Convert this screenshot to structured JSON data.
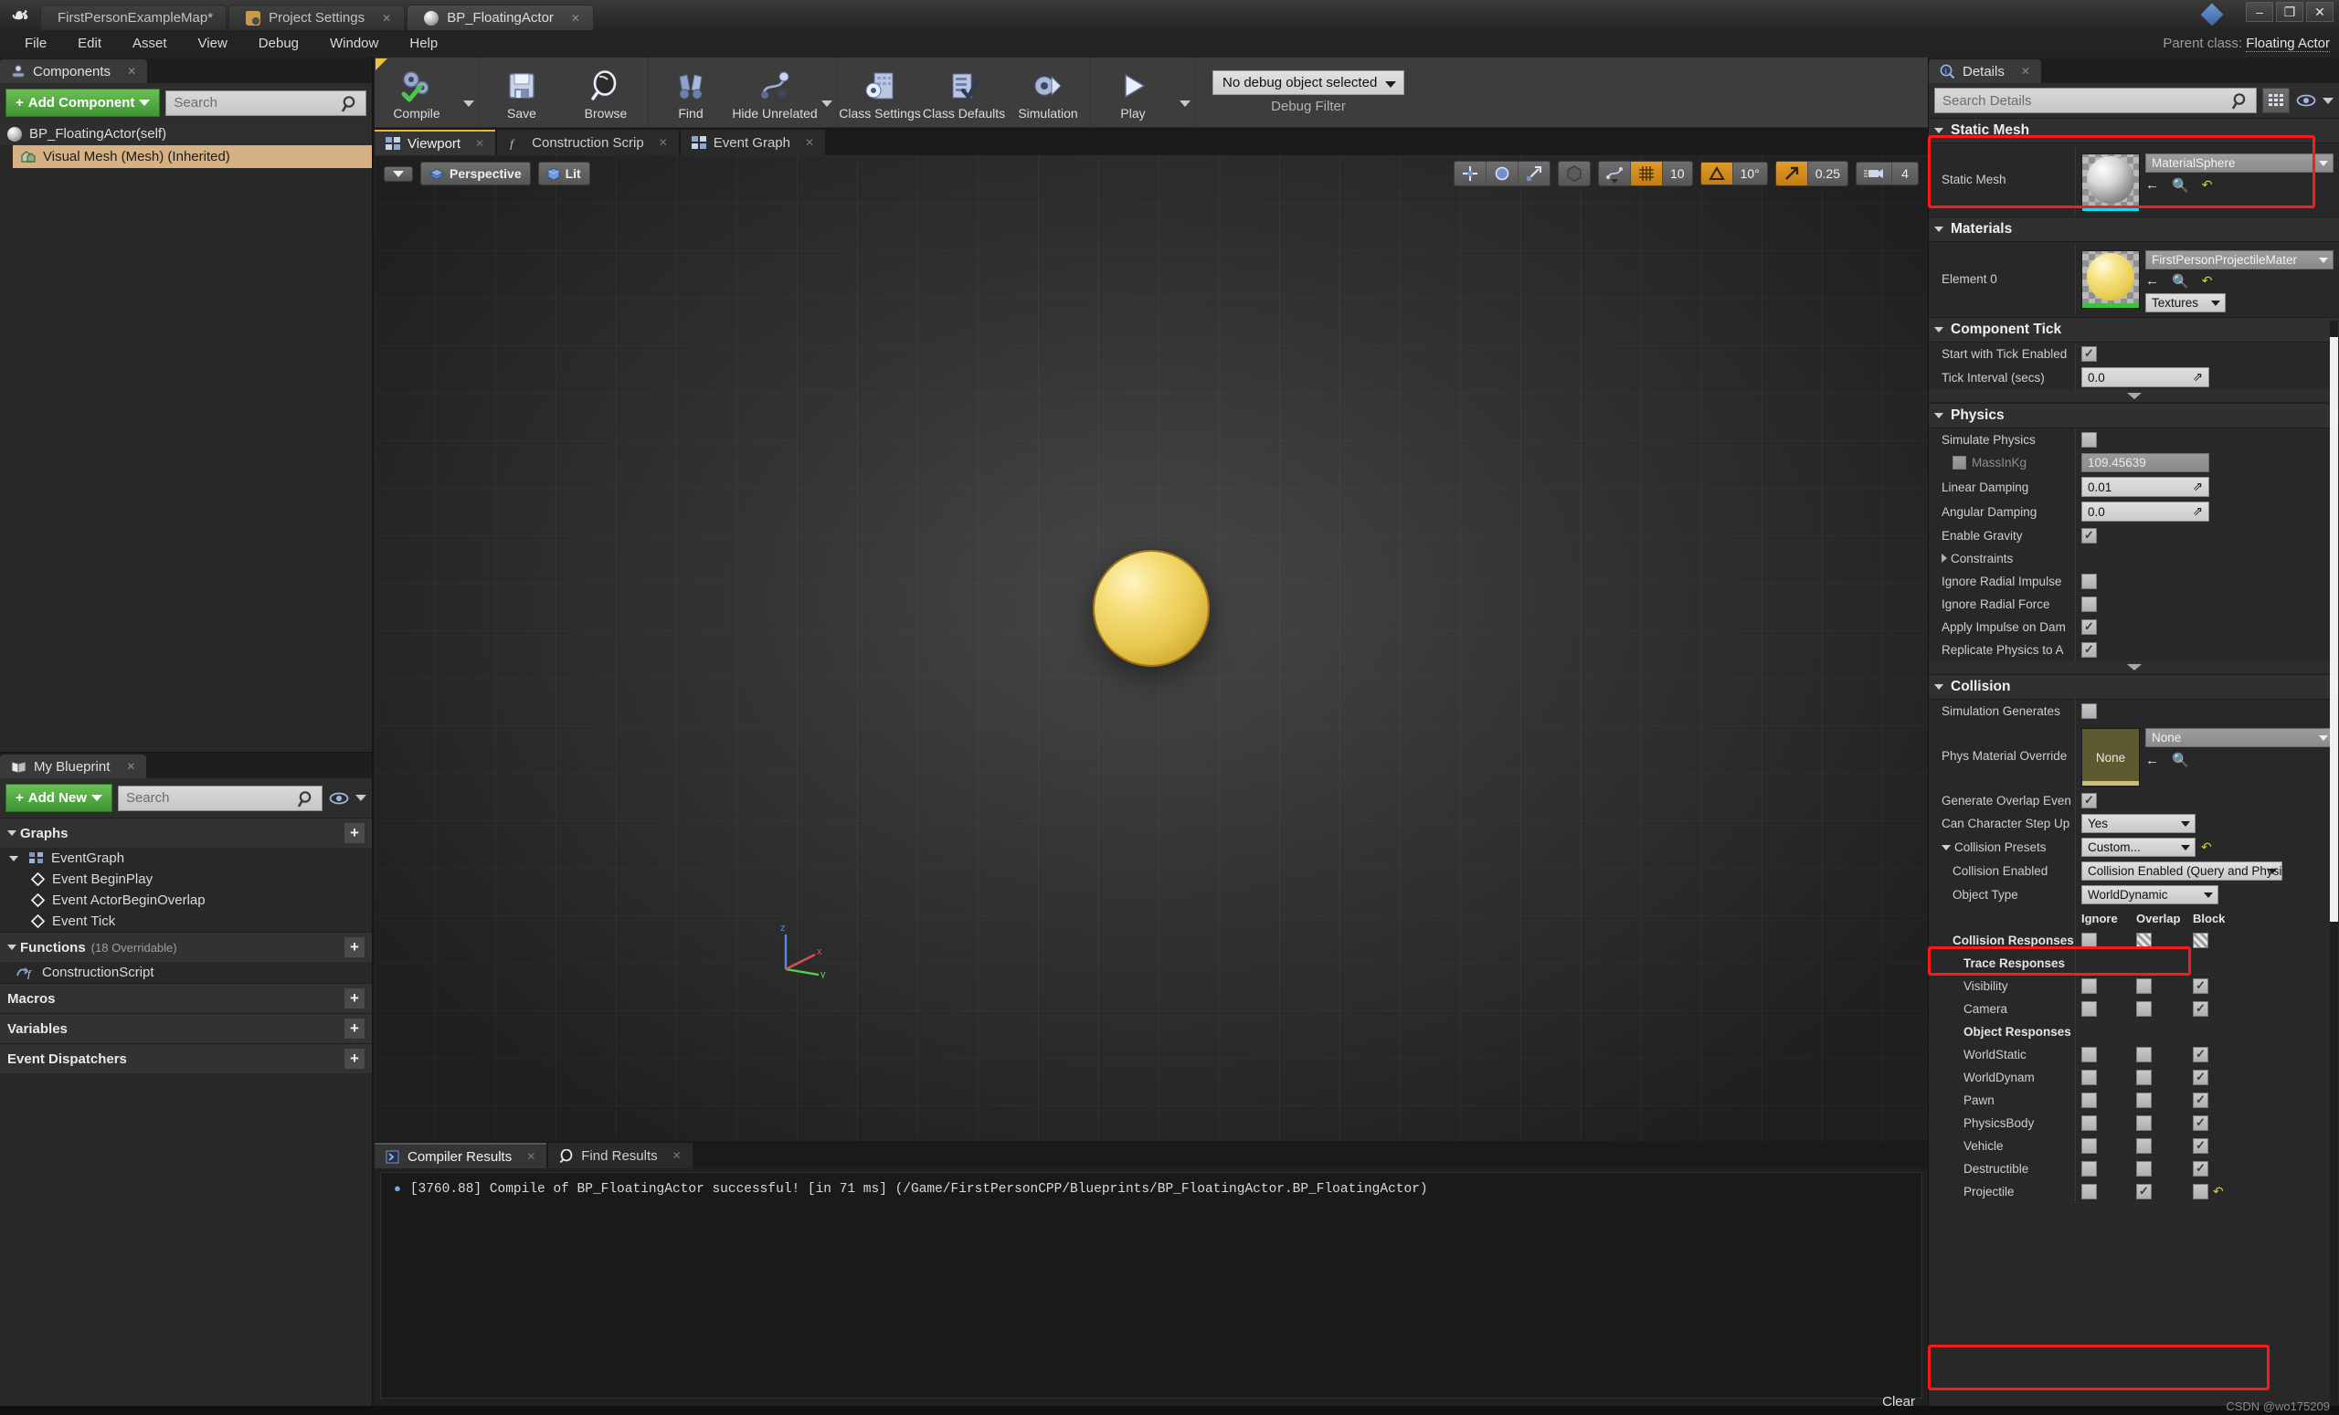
{
  "window": {
    "tabs": [
      {
        "label": "FirstPersonExampleMap*",
        "icon": "none",
        "active": false
      },
      {
        "label": "Project Settings",
        "icon": "folder-icon",
        "active": false,
        "closable": true
      },
      {
        "label": "BP_FloatingActor",
        "icon": "sphere-icon",
        "active": true,
        "closable": true
      }
    ],
    "controls": {
      "minimize": "–",
      "restore": "❐",
      "close": "✕"
    },
    "parent_class_label": "Parent class:",
    "parent_class_value": "Floating Actor"
  },
  "menubar": [
    "File",
    "Edit",
    "Asset",
    "View",
    "Debug",
    "Window",
    "Help"
  ],
  "toolbar": {
    "buttons": [
      {
        "label": "Compile",
        "icon": "compile-gears-icon",
        "caret": true
      },
      {
        "label": "Save",
        "icon": "floppy-icon",
        "caret": false
      },
      {
        "label": "Browse",
        "icon": "magnifier-icon",
        "caret": false
      },
      {
        "label": "Find",
        "icon": "binoculars-icon",
        "caret": false
      },
      {
        "label": "Hide Unrelated",
        "icon": "nodes-icon",
        "caret": true
      },
      {
        "label": "Class Settings",
        "icon": "class-settings-icon",
        "caret": false
      },
      {
        "label": "Class Defaults",
        "icon": "class-defaults-icon",
        "caret": false
      },
      {
        "label": "Simulation",
        "icon": "simulation-icon",
        "caret": false
      },
      {
        "label": "Play",
        "icon": "play-icon",
        "caret": true
      }
    ],
    "debug_filter": {
      "value": "No debug object selected",
      "label": "Debug Filter"
    }
  },
  "components_panel": {
    "tab_label": "Components",
    "add_button": "Add Component",
    "search_placeholder": "Search",
    "items": [
      {
        "label": "BP_FloatingActor(self)",
        "icon": "sphere-icon",
        "selected": false
      },
      {
        "label": "Visual Mesh (Mesh) (Inherited)",
        "icon": "mesh-icon",
        "selected": true
      }
    ]
  },
  "my_blueprint": {
    "tab_label": "My Blueprint",
    "add_button": "Add New",
    "search_placeholder": "Search",
    "sections": [
      {
        "title": "Graphs",
        "sub": "",
        "expandable": true,
        "items": [
          {
            "label": "EventGraph",
            "icon": "graph-icon",
            "indent": 0
          },
          {
            "label": "Event BeginPlay",
            "icon": "event-node-icon",
            "indent": 1
          },
          {
            "label": "Event ActorBeginOverlap",
            "icon": "event-node-icon",
            "indent": 1
          },
          {
            "label": "Event Tick",
            "icon": "event-node-icon",
            "indent": 1
          }
        ]
      },
      {
        "title": "Functions",
        "sub": "(18 Overridable)",
        "expandable": true,
        "items": [
          {
            "label": "ConstructionScript",
            "icon": "function-icon",
            "indent": 0
          }
        ]
      },
      {
        "title": "Macros",
        "sub": "",
        "expandable": false,
        "items": []
      },
      {
        "title": "Variables",
        "sub": "",
        "expandable": false,
        "items": []
      },
      {
        "title": "Event Dispatchers",
        "sub": "",
        "expandable": false,
        "items": []
      }
    ]
  },
  "viewport": {
    "tabs": [
      {
        "label": "Viewport",
        "icon": "viewport-icon",
        "active": true
      },
      {
        "label": "Construction Scrip",
        "icon": "function-icon",
        "active": false
      },
      {
        "label": "Event Graph",
        "icon": "graph-icon",
        "active": false
      }
    ],
    "left_controls": [
      {
        "label": "Perspective",
        "icon": "perspective-icon"
      },
      {
        "label": "Lit",
        "icon": "lit-icon"
      }
    ],
    "right_controls": {
      "transform": [
        "translate-icon",
        "rotate-icon",
        "scale-icon"
      ],
      "coord_system": "world-coords-icon",
      "surface_snap": "surface-snap-icon",
      "grid_snap_enabled": true,
      "grid_snap_value": "10",
      "angle_snap_enabled": true,
      "angle_snap_value": "10°",
      "scale_snap_enabled": true,
      "scale_snap_value": "0.25",
      "camera_speed_value": "4"
    }
  },
  "results_panel": {
    "tabs": [
      {
        "label": "Compiler Results",
        "icon": "compiler-icon",
        "active": true
      },
      {
        "label": "Find Results",
        "icon": "magnifier-icon",
        "active": false
      }
    ],
    "log_lines": [
      "[3760.88] Compile of BP_FloatingActor successful! [in 71 ms] (/Game/FirstPersonCPP/Blueprints/BP_FloatingActor.BP_FloatingActor)"
    ],
    "clear_label": "Clear"
  },
  "details_panel": {
    "tab_label": "Details",
    "search_placeholder": "Search Details",
    "categories": {
      "static_mesh": {
        "title": "Static Mesh",
        "row_label": "Static Mesh",
        "asset_value": "MaterialSphere",
        "thumb_strip_color": "#00e5f0",
        "highlighted": true
      },
      "materials": {
        "title": "Materials",
        "row_label": "Element 0",
        "asset_value": "FirstPersonProjectileMater",
        "textures_button": "Textures",
        "thumb_strip_color": "#3cc13c"
      },
      "component_tick": {
        "title": "Component Tick",
        "rows": [
          {
            "label": "Start with Tick Enabled",
            "type": "checkbox",
            "value": true
          },
          {
            "label": "Tick Interval (secs)",
            "type": "number",
            "value": "0.0"
          }
        ]
      },
      "physics": {
        "title": "Physics",
        "rows": [
          {
            "label": "Simulate Physics",
            "type": "checkbox",
            "value": false
          },
          {
            "label": "MassInKg",
            "type": "number-disabled",
            "value": "109.45639",
            "has_checkbox": true,
            "checkbox_value": false
          },
          {
            "label": "Linear Damping",
            "type": "number",
            "value": "0.01"
          },
          {
            "label": "Angular Damping",
            "type": "number",
            "value": "0.0"
          },
          {
            "label": "Enable Gravity",
            "type": "checkbox",
            "value": true
          },
          {
            "label": "Constraints",
            "type": "expander",
            "value": ""
          },
          {
            "label": "Ignore Radial Impulse",
            "type": "checkbox",
            "value": false
          },
          {
            "label": "Ignore Radial Force",
            "type": "checkbox",
            "value": false
          },
          {
            "label": "Apply Impulse on Dam",
            "type": "checkbox",
            "value": true
          },
          {
            "label": "Replicate Physics to A",
            "type": "checkbox",
            "value": true
          }
        ]
      },
      "collision": {
        "title": "Collision",
        "simulation_generates_label": "Simulation Generates",
        "simulation_generates_value": false,
        "phys_material_label": "Phys Material Override",
        "phys_material_thumb_text": "None",
        "phys_material_value": "None",
        "generate_overlap_label": "Generate Overlap Even",
        "generate_overlap_value": true,
        "generate_overlap_highlighted": true,
        "can_step_up_label": "Can Character Step Up",
        "can_step_up_value": "Yes",
        "collision_presets_label": "Collision Presets",
        "collision_presets_value": "Custom...",
        "collision_enabled_label": "Collision Enabled",
        "collision_enabled_value": "Collision Enabled (Query and Physics)",
        "object_type_label": "Object Type",
        "object_type_value": "WorldDynamic",
        "response_columns": [
          "Ignore",
          "Overlap",
          "Block"
        ],
        "collision_responses_label": "Collision Responses",
        "collision_responses_state": [
          "off",
          "hatch",
          "hatch"
        ],
        "trace_responses_label": "Trace Responses",
        "trace_rows": [
          {
            "label": "Visibility",
            "state": [
              "off",
              "off",
              "on"
            ]
          },
          {
            "label": "Camera",
            "state": [
              "off",
              "off",
              "on"
            ]
          }
        ],
        "object_responses_label": "Object Responses",
        "object_rows": [
          {
            "label": "WorldStatic",
            "state": [
              "off",
              "off",
              "on"
            ],
            "highlighted": false
          },
          {
            "label": "WorldDynam",
            "state": [
              "off",
              "off",
              "on"
            ],
            "highlighted": false
          },
          {
            "label": "Pawn",
            "state": [
              "off",
              "off",
              "on"
            ],
            "highlighted": false
          },
          {
            "label": "PhysicsBody",
            "state": [
              "off",
              "off",
              "on"
            ],
            "highlighted": false
          },
          {
            "label": "Vehicle",
            "state": [
              "off",
              "off",
              "on"
            ],
            "highlighted": false
          },
          {
            "label": "Destructible",
            "state": [
              "off",
              "off",
              "on"
            ],
            "highlighted": true
          },
          {
            "label": "Projectile",
            "state": [
              "off",
              "on",
              "off"
            ],
            "highlighted": true,
            "has_revert": true
          }
        ]
      }
    }
  },
  "watermark": "CSDN @wo175209",
  "colors": {
    "accent_orange": "#e09b28",
    "highlight_red": "#ff1a1a",
    "green_button": "#4f9e3f",
    "selection_tan": "#d6b183"
  }
}
